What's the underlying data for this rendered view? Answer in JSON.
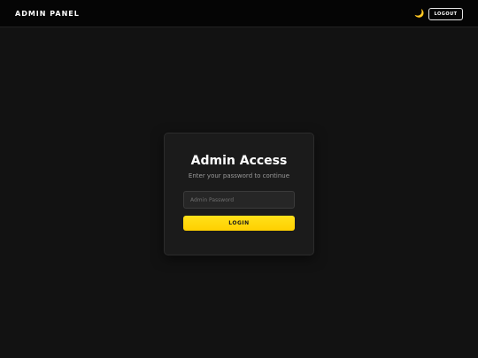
{
  "header": {
    "brand": "ADMIN PANEL",
    "theme_toggle_icon": "🌙",
    "theme_toggle_icon_name": "moon-icon",
    "logout_label": "LOGOUT"
  },
  "login_card": {
    "title": "Admin Access",
    "subtitle": "Enter your password to continue",
    "password_placeholder": "Admin Password",
    "password_value": "",
    "login_label": "LOGIN"
  },
  "colors": {
    "background": "#121212",
    "header_background": "#050505",
    "card_background": "#1b1b1b",
    "accent": "#ffd60a",
    "text_primary": "#ffffff",
    "text_secondary": "#9a9a9a"
  }
}
